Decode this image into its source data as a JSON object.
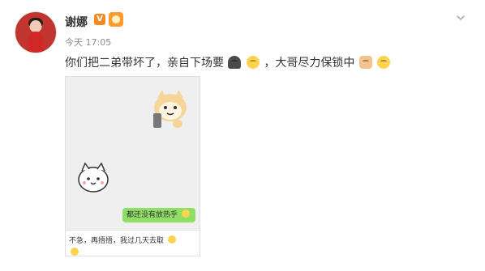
{
  "post": {
    "username": "谢娜",
    "vip_badge": "V",
    "time": "今天 17:05",
    "text": {
      "part1": "你们把二弟带坏了，亲自下场要",
      "part2": "，大哥尽力保锁中"
    }
  },
  "image": {
    "bubble_text": "都还没有放热乎",
    "message_text": "不急，再捂捂，我过几天去取"
  },
  "icons": {
    "menu": "chevron-down-icon",
    "badge": "vip-icon",
    "medal": "medal-icon",
    "emoji_1": "masked-emoji-icon",
    "emoji_2": "face-emoji-icon",
    "emoji_3": "arm-emoji-icon",
    "emoji_4": "smile-emoji-icon"
  }
}
